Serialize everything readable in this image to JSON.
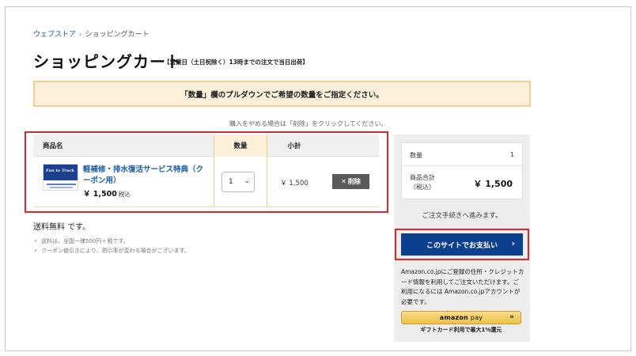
{
  "breadcrumb": {
    "home": "ウェブストア",
    "separator": "›",
    "current": "ショッピングカート"
  },
  "page": {
    "title": "ショッピングカート",
    "title_note": "【営業日（土日祝除く）13時までの注文で当日出荷】"
  },
  "notice": "「数量」欄のプルダウンでご希望の数量をご指定ください。",
  "hint": "購入をやめる場合は「削除」をクリックしてください。",
  "table": {
    "headers": {
      "name": "商品名",
      "quantity": "数量",
      "subtotal": "小計"
    },
    "items": [
      {
        "thumb_text": "Fun to Truck",
        "name": "軽補修・排水復活サービス特典（クーポン用）",
        "price": "￥ 1,500",
        "tax_label": "税込",
        "quantity": "1",
        "subtotal": "￥ 1,500",
        "delete_label": "削除",
        "delete_icon": "✕"
      }
    ]
  },
  "shipping": "送料無料 です。",
  "notes": [
    "送料は、全国一律500円＋税です。",
    "クーポン値引きにより、割引率が変わる場合がございます。"
  ],
  "summary": {
    "qty_label": "数量",
    "qty_value": "1",
    "total_label_1": "商品合計",
    "total_label_2": "（税込）",
    "total_value": "￥ 1,500"
  },
  "proceed_text": "ご注文手続きへ進みます。",
  "pay_button": {
    "label": "このサイトでお支払い",
    "chevron": "›"
  },
  "amazon": {
    "description": "Amazon.co.jpにご登録の住所・クレジットカード情報を利用してご注文いただけます。ご利用になるには Amazon.co.jpアカウントが必要です。",
    "logo_text": "amazon",
    "logo_pay": "pay",
    "chevron": "»",
    "sub_label": "ギフトカード利用で最大1%還元"
  },
  "colors": {
    "accent_blue": "#0d3f8f",
    "link_blue": "#1a5aa6",
    "notice_bg": "#fcf0da",
    "highlight_red": "#e0252f",
    "amazon_yellow": "#f0c14b"
  }
}
